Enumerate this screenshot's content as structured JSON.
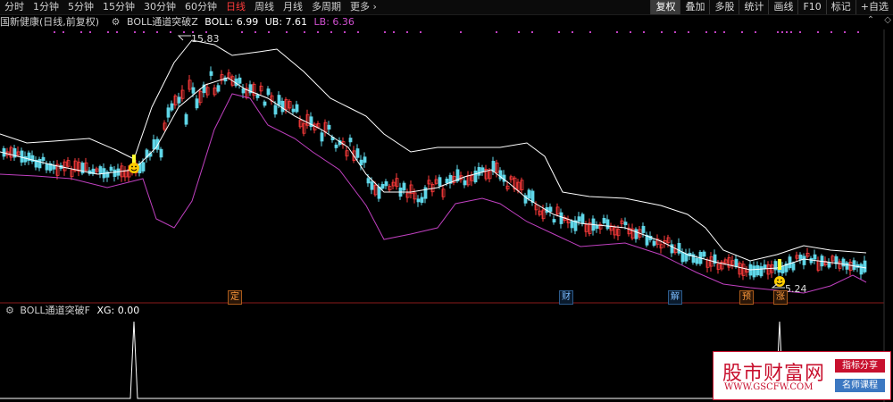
{
  "toolbar": {
    "timeframes": [
      "分时",
      "1分钟",
      "5分钟",
      "15分钟",
      "30分钟",
      "60分钟",
      "日线",
      "周线",
      "月线",
      "多周期",
      "更多"
    ],
    "active_timeframe": "日线",
    "tools": [
      "复权",
      "叠加",
      "多股",
      "统计",
      "画线",
      "F10",
      "标记",
      "+自选"
    ],
    "active_tool": "复权"
  },
  "title": {
    "stock_name": "国新健康(日线,前复权)",
    "indicator": "BOLL通道突破Z",
    "boll": "BOLL: 6.99",
    "ub": "UB: 7.61",
    "lb": "LB: 6.36"
  },
  "lower": {
    "indicator": "BOLL通道突破F",
    "xg": "XG: 0.00"
  },
  "annotations": {
    "high_price": "15.83",
    "low_price": "5.24"
  },
  "events": [
    {
      "label": "定",
      "color": "orange"
    },
    {
      "label": "财",
      "color": "blue"
    },
    {
      "label": "解",
      "color": "blue"
    },
    {
      "label": "预",
      "color": "orange"
    },
    {
      "label": "涨",
      "color": "orange"
    }
  ],
  "watermark": {
    "name": "股市财富网",
    "url": "WWW.GSCFW.COM",
    "tag1": "指标分享",
    "tag2": "名师课程"
  },
  "colors": {
    "up": "#ff3b3b",
    "down": "#5fd6e8",
    "boll": "#ffffff",
    "lb": "#c040c0",
    "signal": "#ffff33"
  }
}
